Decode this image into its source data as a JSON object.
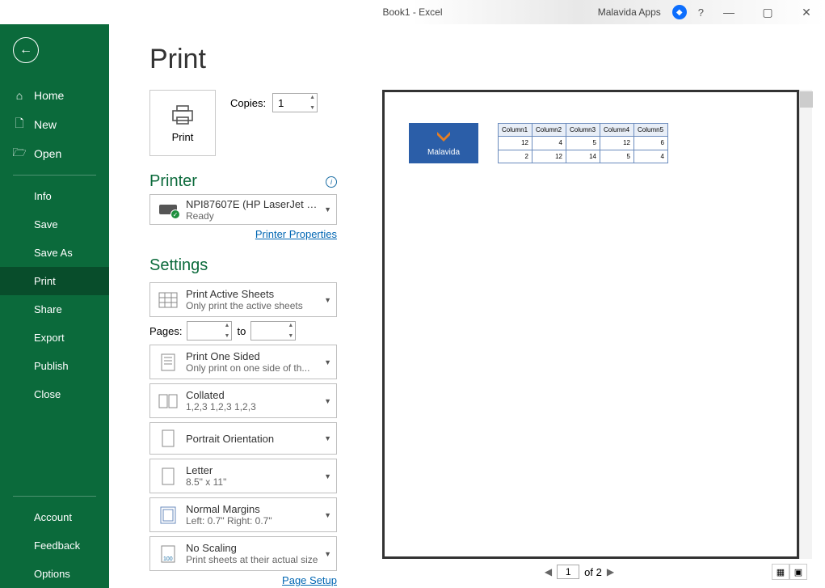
{
  "title": "Book1 - Excel",
  "mv_label": "Malavida Apps",
  "help_label": "?",
  "page_heading": "Print",
  "sidebar": {
    "back": "←",
    "items": [
      {
        "icon": "home",
        "label": "Home"
      },
      {
        "icon": "doc",
        "label": "New"
      },
      {
        "icon": "open",
        "label": "Open"
      }
    ],
    "subitems": [
      "Info",
      "Save",
      "Save As",
      "Print",
      "Share",
      "Export",
      "Publish",
      "Close"
    ],
    "active_sub": "Print",
    "bottom": [
      "Account",
      "Feedback",
      "Options"
    ]
  },
  "print_button": "Print",
  "copies": {
    "label": "Copies:",
    "value": "1"
  },
  "printer": {
    "heading": "Printer",
    "name": "NPI87607E (HP LaserJet M15...",
    "status": "Ready",
    "props_link": "Printer Properties"
  },
  "settings": {
    "heading": "Settings",
    "r1": {
      "t1": "Print Active Sheets",
      "t2": "Only print the active sheets"
    },
    "pages_label": "Pages:",
    "pages_to": "to",
    "r2": {
      "t1": "Print One Sided",
      "t2": "Only print on one side of th..."
    },
    "r3": {
      "t1": "Collated",
      "t2": "1,2,3    1,2,3    1,2,3"
    },
    "r4": {
      "t1": "Portrait Orientation",
      "t2": ""
    },
    "r5": {
      "t1": "Letter",
      "t2": "8.5\" x 11\""
    },
    "r6": {
      "t1": "Normal Margins",
      "t2": "Left: 0.7\"    Right: 0.7\""
    },
    "r7": {
      "t1": "No Scaling",
      "t2": "Print sheets at their actual size"
    },
    "page_setup": "Page Setup"
  },
  "preview": {
    "logo_text": "Malavida",
    "headers": [
      "Column1",
      "Column2",
      "Column3",
      "Column4",
      "Column5"
    ],
    "rows": [
      [
        "12",
        "4",
        "5",
        "12",
        "6"
      ],
      [
        "2",
        "12",
        "14",
        "5",
        "4"
      ]
    ]
  },
  "pager": {
    "current": "1",
    "total": "of 2"
  }
}
